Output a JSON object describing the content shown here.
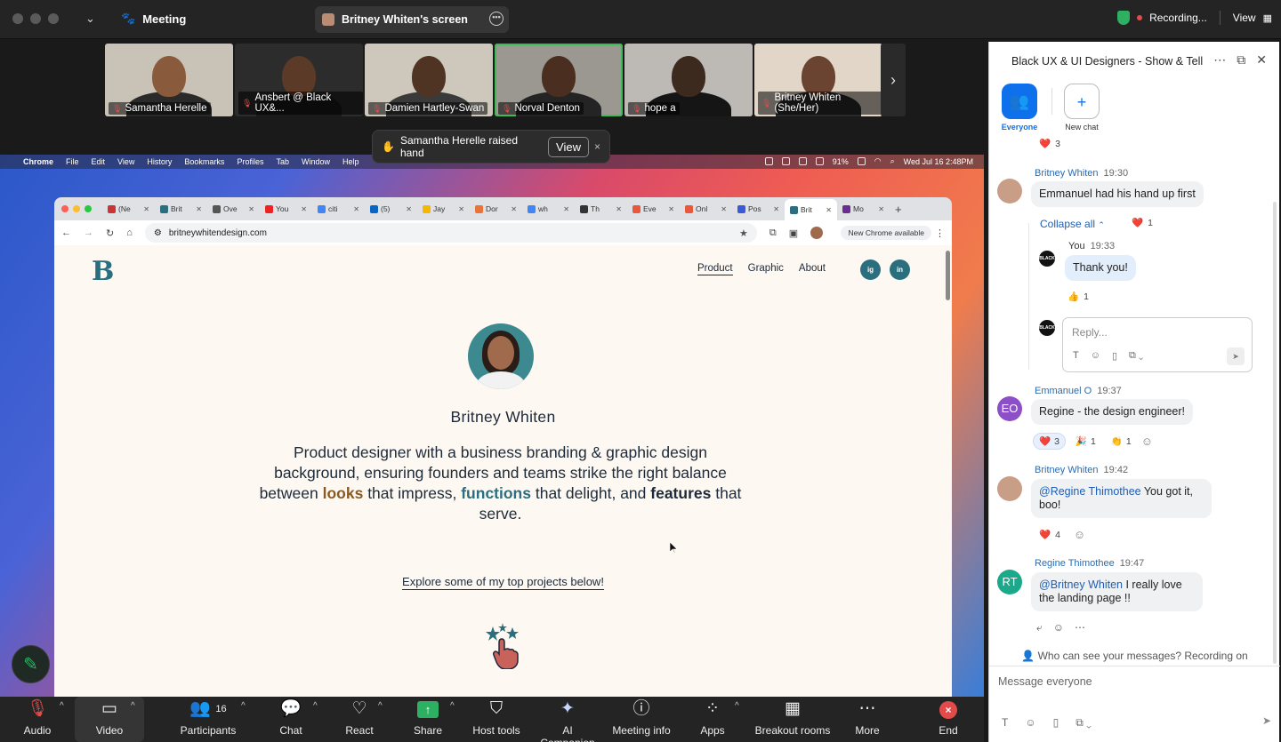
{
  "zoom": {
    "meeting_label": "Meeting",
    "screen_tab": "Britney Whiten's screen",
    "recording": "Recording...",
    "view": "View",
    "gallery": [
      {
        "name": "Samantha Herelle",
        "bg": "#c9c2b6",
        "skin": "#8a5a3c",
        "shirt": "#2a2a2a"
      },
      {
        "name": "Ansbert @ Black UX&...",
        "bg": "#2c2c2c",
        "skin": "#5c3a28",
        "shirt": "#1a1a1a"
      },
      {
        "name": "Damien Hartley-Swan",
        "bg": "#cdc7bc",
        "skin": "#4f3323",
        "shirt": "#3a3a3a"
      },
      {
        "name": "Norval Denton",
        "bg": "#9a9890",
        "skin": "#4a2e20",
        "shirt": "#242424"
      },
      {
        "name": "hope a",
        "bg": "#bdbab5",
        "skin": "#3d2a1f",
        "shirt": "#151515"
      },
      {
        "name": "Britney Whiten (She/Her)",
        "bg": "#e2d6c8",
        "skin": "#6b4331",
        "shirt": "#2a2a2a"
      }
    ],
    "toast": {
      "text": "Samantha Herelle raised hand",
      "button": "View",
      "close": "×"
    },
    "toolbar": {
      "audio": "Audio",
      "video": "Video",
      "participants": "Participants",
      "participants_count": "16",
      "chat": "Chat",
      "react": "React",
      "share": "Share",
      "host_tools": "Host tools",
      "ai_companion": "AI Companion",
      "meeting_info": "Meeting info",
      "apps": "Apps",
      "breakout_rooms": "Breakout rooms",
      "more": "More",
      "end": "End"
    }
  },
  "mac": {
    "menu": [
      "Chrome",
      "File",
      "Edit",
      "View",
      "History",
      "Bookmarks",
      "Profiles",
      "Tab",
      "Window",
      "Help"
    ],
    "battery": "91%",
    "datetime": "Wed Jul 16  2:48PM"
  },
  "browser": {
    "tabs": [
      {
        "label": "(Ne",
        "color": "#c33"
      },
      {
        "label": "Brit",
        "color": "#2b6e7e"
      },
      {
        "label": "Ove",
        "color": "#555"
      },
      {
        "label": "You",
        "color": "#e22"
      },
      {
        "label": "citi",
        "color": "#4285f4"
      },
      {
        "label": "(5)",
        "color": "#0a66c2"
      },
      {
        "label": "Jay",
        "color": "#f5b700"
      },
      {
        "label": "Dor",
        "color": "#e8743b"
      },
      {
        "label": "wh",
        "color": "#4285f4"
      },
      {
        "label": "Th",
        "color": "#333"
      },
      {
        "label": "Eve",
        "color": "#e8593b"
      },
      {
        "label": "Onl",
        "color": "#e8593b"
      },
      {
        "label": "Pos",
        "color": "#3a5ad8"
      },
      {
        "label": "Brit",
        "color": "#2b6e7e"
      },
      {
        "label": "Mo",
        "color": "#6a2c91"
      }
    ],
    "url": "britneywhitendesign.com",
    "new_chrome": "New Chrome available"
  },
  "site": {
    "nav": [
      "Product",
      "Graphic",
      "About"
    ],
    "social": [
      "ig",
      "in"
    ],
    "name": "Britney Whiten",
    "tagline": {
      "p1": "Product designer with a business branding & graphic design background, ensuring founders and teams strike the right balance between ",
      "looks": "looks",
      "p2": " that impress, ",
      "functions": "functions",
      "p3": " that delight, and ",
      "features": "features",
      "p4": " that serve."
    },
    "explore": "Explore some of my top projects below!"
  },
  "chat": {
    "title": "Black UX & UI Designers  - Show & Tell",
    "channels": {
      "everyone": "Everyone",
      "new_chat": "New chat"
    },
    "top_reaction_count": "3",
    "m1": {
      "author": "Britney Whiten",
      "time": "19:30",
      "text": "Emmanuel had his hand up first"
    },
    "collapse_all": "Collapse all",
    "collapse_heart_count": "1",
    "reply1": {
      "author": "You",
      "time": "19:33",
      "text": "Thank you!",
      "reaction_count": "1"
    },
    "reply_placeholder": "Reply...",
    "m2": {
      "author": "Emmanuel O",
      "initials": "EO",
      "time": "19:37",
      "text": "Regine - the design engineer!",
      "r_heart": "3",
      "r_party": "1",
      "r_clap": "1"
    },
    "m3": {
      "author": "Britney Whiten",
      "time": "19:42",
      "mention": "@Regine Thimothee",
      "text": " You got it, boo!",
      "r_heart": "4"
    },
    "m4": {
      "author": "Regine Thimothee",
      "initials": "RT",
      "time": "19:47",
      "mention": "@Britney Whiten",
      "text": "  I really love the landing page !!"
    },
    "visibility": "Who can see your messages? Recording on",
    "input_placeholder": "Message everyone"
  }
}
